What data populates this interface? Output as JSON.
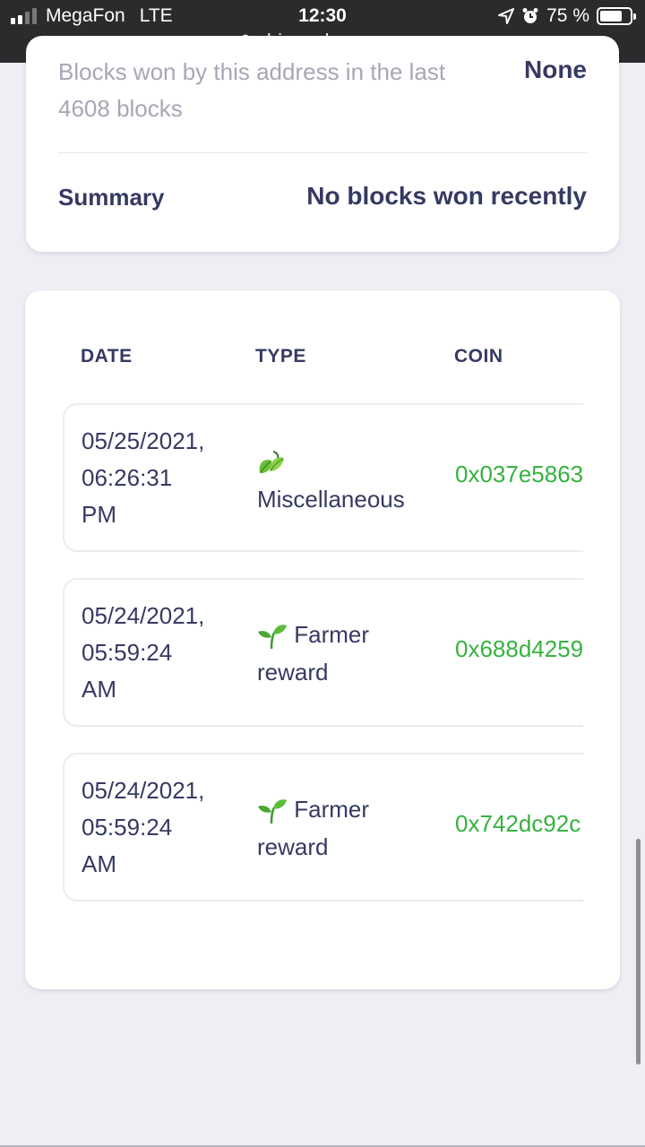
{
  "status_bar": {
    "carrier": "MegaFon",
    "network": "LTE",
    "time": "12:30",
    "battery": "75 %",
    "battery_level": 0.75,
    "url": "chiaexplorer.com"
  },
  "summary_card": {
    "blocks_won_label": "Blocks won by this address in the last 4608 blocks",
    "blocks_won_value": "None",
    "summary_label": "Summary",
    "summary_value": "No blocks won recently"
  },
  "transactions": {
    "columns": [
      "DATE",
      "TYPE",
      "COIN"
    ],
    "rows": [
      {
        "date_line1": "05/25/2021,",
        "date_line2": "06:26:31",
        "date_line3": "PM",
        "type_icon": "leaves-icon",
        "type_line1": "",
        "type_line2": "Miscellaneous",
        "coin": "0x037e5863"
      },
      {
        "date_line1": "05/24/2021,",
        "date_line2": "05:59:24",
        "date_line3": "AM",
        "type_icon": "seedling-icon",
        "type_line1": "Farmer",
        "type_line2": "reward",
        "coin": "0x688d4259"
      },
      {
        "date_line1": "05/24/2021,",
        "date_line2": "05:59:24",
        "date_line3": "AM",
        "type_icon": "seedling-icon",
        "type_line1": "Farmer",
        "type_line2": "reward",
        "coin": "0x742dc92c"
      }
    ]
  },
  "colors": {
    "coin_green": "#36b23f",
    "heading_navy": "#353a62",
    "muted_gray": "#a6a8b4",
    "page_bg": "#eeeef5"
  }
}
